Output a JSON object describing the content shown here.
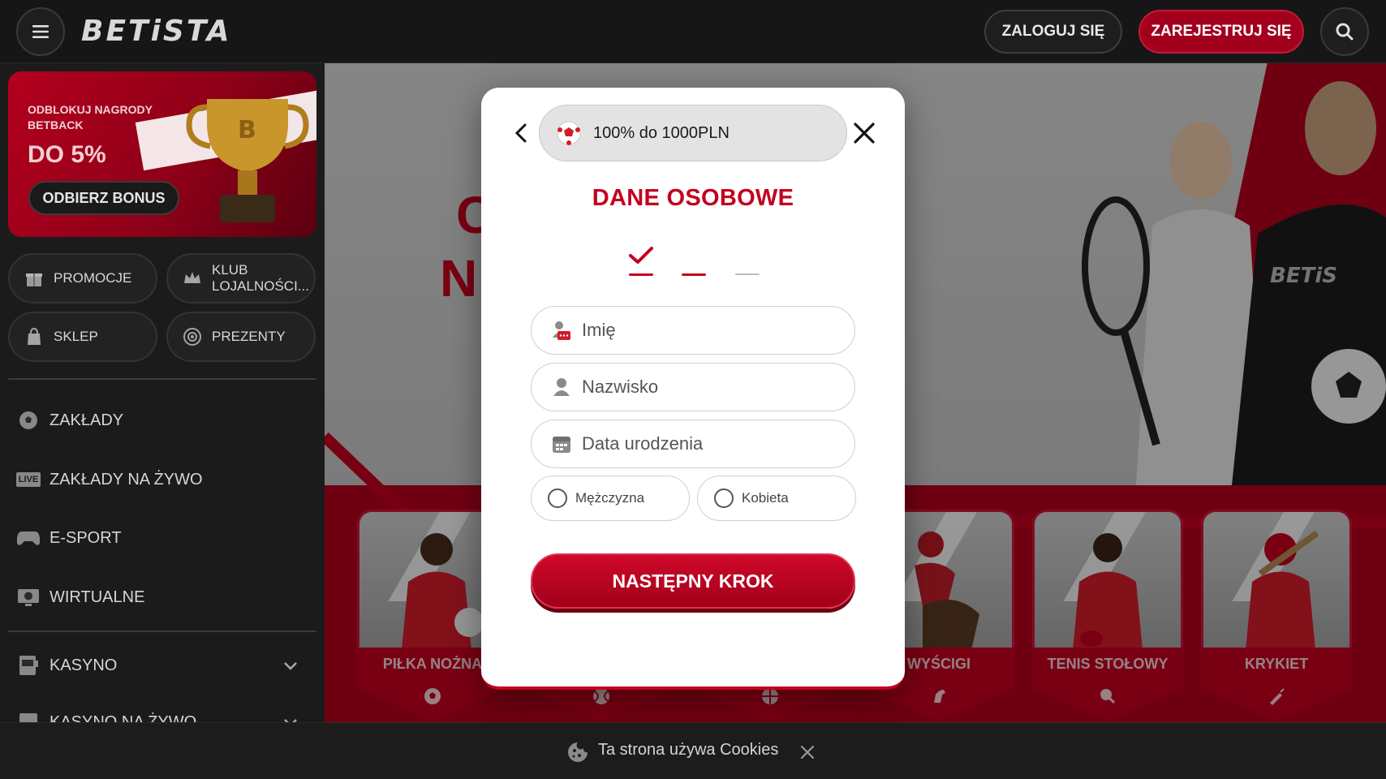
{
  "header": {
    "logo": "BETiSTA",
    "login_label": "ZALOGUJ SIĘ",
    "register_label": "ZAREJESTRUJ SIĘ"
  },
  "sidebar": {
    "promo": {
      "title": "ODBLOKUJ NAGRODY BETBACK",
      "big": "DO 5%",
      "button": "ODBIERZ BONUS"
    },
    "quick_links": [
      {
        "label": "PROMOCJE",
        "icon": "gift-icon"
      },
      {
        "label": "KLUB LOJALNOŚCI...",
        "icon": "crown-icon"
      },
      {
        "label": "SKLEP",
        "icon": "bag-icon"
      },
      {
        "label": "PREZENTY",
        "icon": "wheel-icon"
      }
    ],
    "nav": [
      {
        "label": "ZAKŁADY",
        "icon": "soccer-ball-icon"
      },
      {
        "label": "ZAKŁADY NA ŻYWO",
        "icon": "live-icon",
        "badge": "LIVE"
      },
      {
        "label": "E-SPORT",
        "icon": "gamepad-icon"
      },
      {
        "label": "WIRTUALNE",
        "icon": "monitor-icon"
      },
      {
        "label": "KASYNO",
        "icon": "slot-machine-icon"
      },
      {
        "label": "KASYNO NA ŻYWO",
        "icon": "dealer-icon"
      }
    ]
  },
  "hero": {
    "text_line1": "C",
    "text_line2": "N",
    "banner_logo": "BETiS"
  },
  "sports": [
    {
      "name": "PIŁKA NOŻNA",
      "icon": "soccer-ball-icon"
    },
    {
      "name": "",
      "icon": "tennis-ball-icon"
    },
    {
      "name": "",
      "icon": "basketball-icon"
    },
    {
      "name": "WYŚCIGI",
      "icon": "horse-icon"
    },
    {
      "name": "TENIS STOŁOWY",
      "icon": "ping-pong-icon"
    },
    {
      "name": "KRYKIET",
      "icon": "cricket-bat-icon"
    }
  ],
  "modal": {
    "bonus": "100% do 1000PLN",
    "title": "DANE OSOBOWE",
    "steps": [
      "done",
      "active",
      "pending"
    ],
    "fields": {
      "first_name": "Imię",
      "last_name": "Nazwisko",
      "birth_date": "Data urodzenia"
    },
    "gender": {
      "male": "Mężczyzna",
      "female": "Kobieta"
    },
    "next_button": "NASTĘPNY KROK"
  },
  "cookie": {
    "text": "Ta strona używa Cookies"
  },
  "colors": {
    "brand_red": "#c3001f",
    "dark_bg": "#1b1b1b"
  }
}
